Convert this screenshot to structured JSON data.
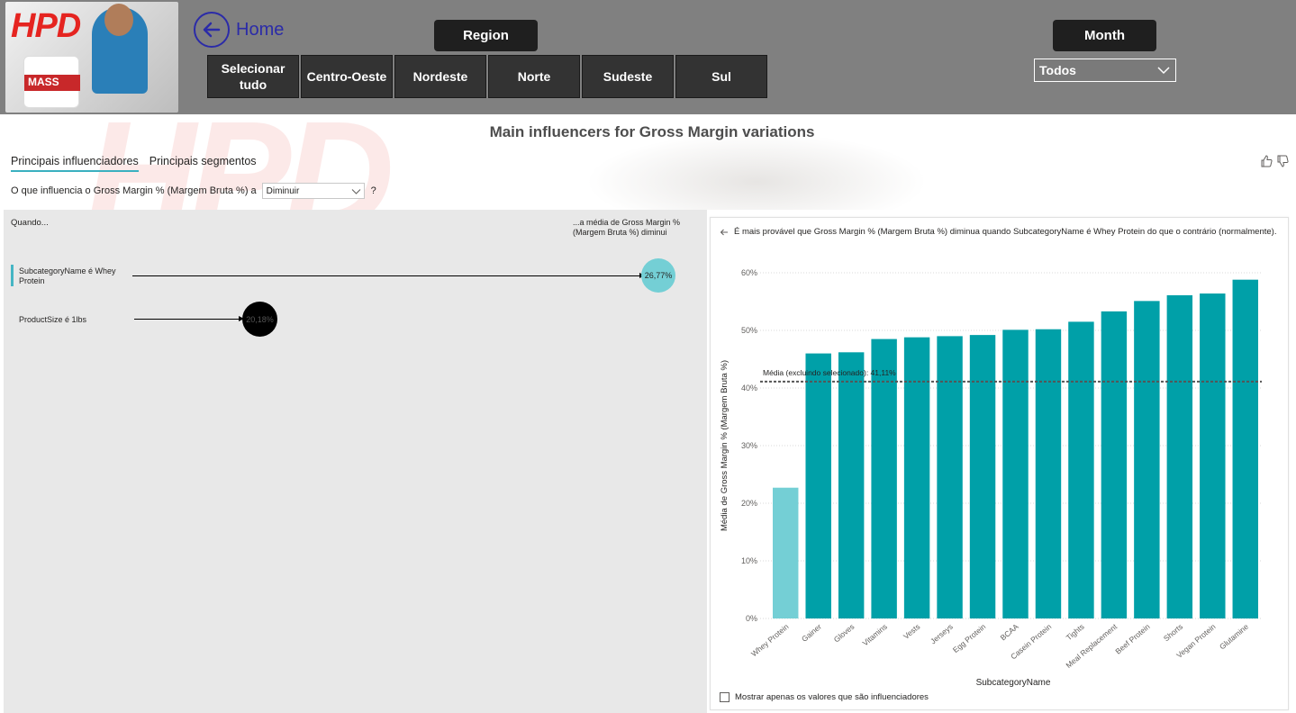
{
  "header": {
    "logo_text": "HPD",
    "logo_product_label": "MASS",
    "home_label": "Home",
    "region_title": "Region",
    "month_title": "Month",
    "region_options": [
      "Selecionar tudo",
      "Centro-Oeste",
      "Nordeste",
      "Norte",
      "Sudeste",
      "Sul"
    ],
    "month_value": "Todos"
  },
  "visual": {
    "title": "Main influencers for Gross Margin variations",
    "tabs": [
      "Principais influenciadores",
      "Principais segmentos"
    ],
    "active_tab": 0,
    "question_prefix": "O que influencia o Gross Margin % (Margem Bruta %) a",
    "direction_value": "Diminuir",
    "help": "?",
    "when_label": "Quando...",
    "avg_header": "...a média de Gross Margin % (Margem Bruta %) diminui",
    "influencers": [
      {
        "condition": "SubcategoryName é Whey Protein",
        "value": "26,77%",
        "selected": true
      },
      {
        "condition": "ProductSize é 1lbs",
        "value": "20,18%",
        "selected": false
      }
    ],
    "chart_description": "É mais provável que Gross Margin % (Margem Bruta %) diminua quando SubcategoryName é Whey Protein do que o contrário (normalmente).",
    "show_only_label": "Mostrar apenas os valores que são influenciadores"
  },
  "colors": {
    "header_bg": "#808080",
    "accent_teal": "#00A0A8",
    "highlight_teal": "#74CFD5",
    "home_blue": "#2B2BA8",
    "brand_red": "#E52420"
  },
  "chart_data": {
    "type": "bar",
    "categories": [
      "Whey Protein",
      "Gainer",
      "Gloves",
      "Vitamins",
      "Vests",
      "Jerseys",
      "Egg Protein",
      "BCAA",
      "Casein Protein",
      "Tights",
      "Meal Replacement",
      "Beef Protein",
      "Shorts",
      "Vegan Protein",
      "Glutamine"
    ],
    "values": [
      22.7,
      46.0,
      46.2,
      48.5,
      48.8,
      49.0,
      49.2,
      50.1,
      50.2,
      51.5,
      53.3,
      55.1,
      56.1,
      56.4,
      58.8
    ],
    "highlighted_category": "Whey Protein",
    "reference_line": {
      "label": "Média (excluindo selecionado): 41,11%",
      "value": 41.11
    },
    "ylabel": "Média de Gross Margin % (Margem Bruta %)",
    "xlabel": "SubcategoryName",
    "yticks": [
      "0%",
      "10%",
      "20%",
      "30%",
      "40%",
      "50%",
      "60%"
    ],
    "ylim": [
      0,
      60
    ],
    "grid": true,
    "legend": "none"
  }
}
